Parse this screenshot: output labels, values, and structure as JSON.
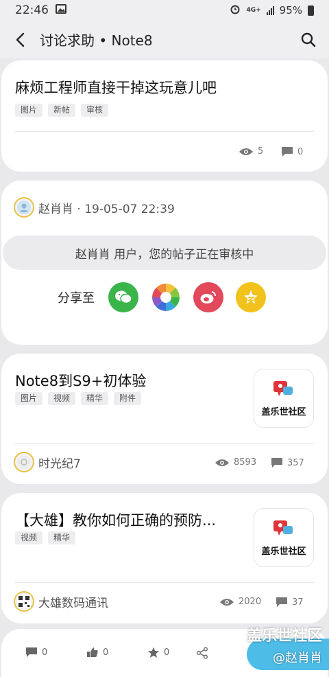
{
  "status_bar": {
    "time": "22:46",
    "battery": "95%"
  },
  "header": {
    "title": "讨论求助 • Note8"
  },
  "post1": {
    "title": "麻烦工程师直接干掉这玩意儿吧",
    "tags": [
      "图片",
      "新帖",
      "审核"
    ],
    "views": "5",
    "comments": "0"
  },
  "review": {
    "author": "赵肖肖 · 19-05-07 22:39",
    "notice": "赵肖肖 用户，您的帖子正在审核中",
    "share_label": "分享至",
    "share_targets": [
      "wechat-icon",
      "moments-icon",
      "weibo-icon",
      "qzone-icon"
    ]
  },
  "post2": {
    "title": "Note8到S9+初体验",
    "tags": [
      "图片",
      "视频",
      "精华",
      "附件"
    ],
    "thumb_label": "盖乐世社区",
    "author": "时光纪7",
    "views": "8593",
    "comments": "357"
  },
  "post3": {
    "title": "【大雄】教你如何正确的预防...",
    "tags": [
      "视频",
      "精华"
    ],
    "thumb_label": "盖乐世社区",
    "author": "大雄数码通讯",
    "views": "2020",
    "comments": "37"
  },
  "bottom_bar": {
    "comments": "0",
    "likes": "0",
    "favorites": "0"
  },
  "watermark": {
    "line1": "盖乐世社区",
    "line2": "@赵肖肖"
  }
}
